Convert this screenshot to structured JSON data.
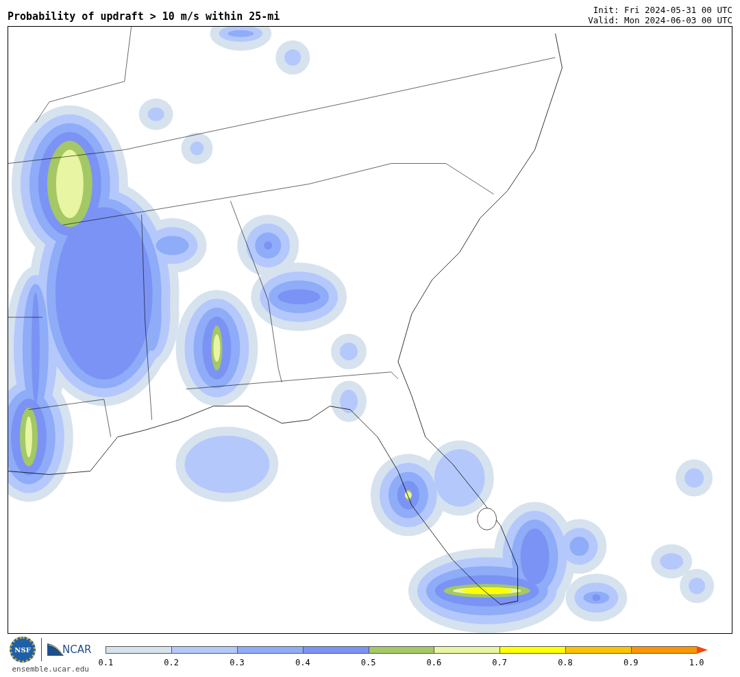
{
  "header": {
    "title": "Probability of updraft > 10 m/s within 25-mi",
    "init": "Init: Fri 2024-05-31 00 UTC",
    "valid": "Valid: Mon 2024-06-03 00 UTC"
  },
  "footer": {
    "logos": [
      {
        "kind": "nsf",
        "text": "NSF"
      },
      {
        "kind": "ncar",
        "text": "NCAR"
      }
    ],
    "url": "ensemble.ucar.edu"
  },
  "legend": {
    "segments": [
      {
        "color": "#d6e2ee"
      },
      {
        "color": "#b4c8fb"
      },
      {
        "color": "#8eacf7"
      },
      {
        "color": "#7b93f4"
      },
      {
        "color": "#a4c865"
      },
      {
        "color": "#e8f5a2"
      },
      {
        "color": "#ffff00"
      },
      {
        "color": "#fcc400"
      },
      {
        "color": "#fb9500"
      },
      {
        "kind": "arrow",
        "color": "#ee4a12"
      }
    ],
    "ticks": [
      "0.1",
      "0.2",
      "0.3",
      "0.4",
      "0.5",
      "0.6",
      "0.7",
      "0.8",
      "0.9",
      "1.0"
    ]
  }
}
